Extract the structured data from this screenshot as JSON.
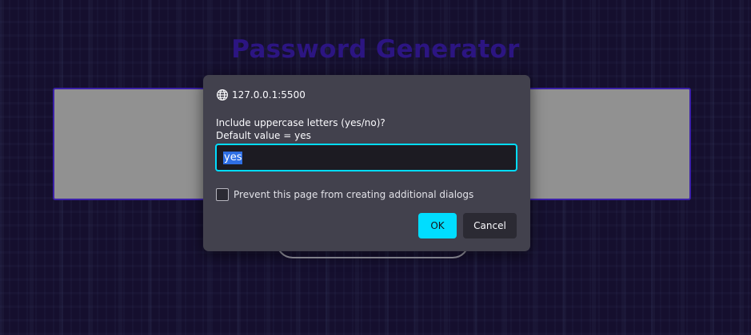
{
  "page": {
    "title": "Password Generator",
    "colors": {
      "background": "#150f2e",
      "title": "#2c1582",
      "password_box": "#919191",
      "password_box_border": "#3b20a8"
    }
  },
  "dialog": {
    "origin": "127.0.0.1:5500",
    "origin_icon": "globe-icon",
    "message_line1": "Include uppercase letters (yes/no)?",
    "message_line2": "Default value = yes",
    "input_value": "yes",
    "checkbox_label": "Prevent this page from creating additional dialogs",
    "checkbox_checked": false,
    "ok_label": "OK",
    "cancel_label": "Cancel",
    "colors": {
      "background": "#42414d",
      "accent": "#00ddff",
      "input_background": "#1c1b22",
      "selection": "#2f6fe4"
    }
  }
}
